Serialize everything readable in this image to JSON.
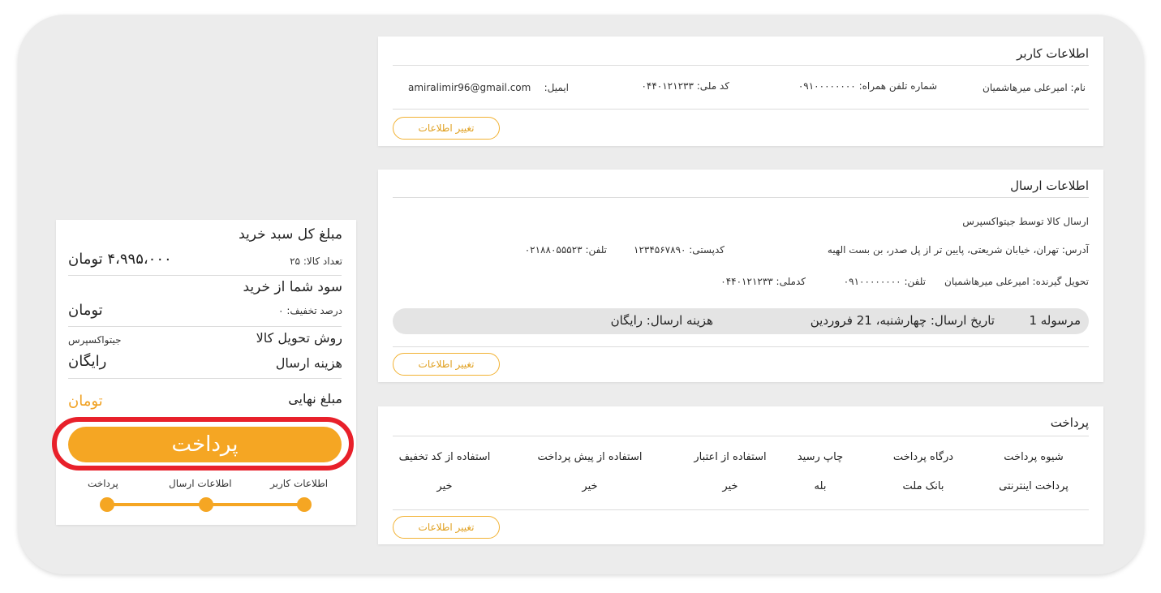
{
  "user_info": {
    "title": "اطلاعات کاربر",
    "name": "نام: امیرعلی میرهاشمیان",
    "phone": "شماره تلفن همراه: ۰۹۱۰۰۰۰۰۰۰۰",
    "national_code": "کد ملی: ۰۴۴۰۱۲۱۲۳۳",
    "email_label": "ایمیل:",
    "email_value": "amiralimir96@gmail.com",
    "edit_label": "تغییر اطلاعات"
  },
  "shipping_info": {
    "title": "اطلاعات ارسال",
    "carrier": "ارسال کالا توسط جیتواکسپرس",
    "address": "آدرس: تهران، خیابان شریعتی، پایین تر از پل صدر، بن بست الهیه",
    "postal": "کدپستی: ۱۲۳۴۵۶۷۸۹۰",
    "phone": "تلفن: ۰۲۱۸۸۰۵۵۵۲۳",
    "receiver": "تحویل گیرنده: امیرعلی میرهاشمیان",
    "receiver_phone": "تلفن: ۰۹۱۰۰۰۰۰۰۰۰",
    "receiver_national": "کدملی: ۰۴۴۰۱۲۱۲۳۳",
    "parcel": "مرسوله 1",
    "send_date": "تاریخ ارسال: چهارشنبه، 21 فروردین",
    "send_cost": "هزینه ارسال: رایگان",
    "edit_label": "تغییر اطلاعات"
  },
  "payment": {
    "title": "پرداخت",
    "headers": [
      "شیوه پرداخت",
      "درگاه پرداخت",
      "چاپ رسید",
      "استفاده از اعتبار",
      "استفاده از پیش پرداخت",
      "استفاده از کد تخفیف"
    ],
    "values": [
      "پرداخت اینترنتی",
      "بانک ملت",
      "بله",
      "خیر",
      "خیر",
      "خیر"
    ],
    "edit_label": "تغییر اطلاعات"
  },
  "summary": {
    "cart_total_label": "مبلغ کل سبد خرید",
    "item_count": "تعداد کالا: ۲۵",
    "cart_total_value": "۴،۹۹۵،۰۰۰ تومان",
    "profit_label": "سود شما از خرید",
    "discount_percent": "درصد تخفیف: ۰",
    "profit_value": "تومان",
    "delivery_label": "روش تحویل کالا",
    "delivery_value": "جیتواکسپرس",
    "shipping_cost_label": "هزینه ارسال",
    "shipping_cost_value": "رایگان",
    "final_label": "مبلغ نهایی",
    "final_value": "تومان",
    "pay_button": "پرداخت"
  },
  "steps": [
    "اطلاعات کاربر",
    "اطلاعات ارسال",
    "پرداخت"
  ],
  "colors": {
    "accent": "#f5a623",
    "highlight_ring": "#e8202a",
    "background": "#ececec"
  }
}
